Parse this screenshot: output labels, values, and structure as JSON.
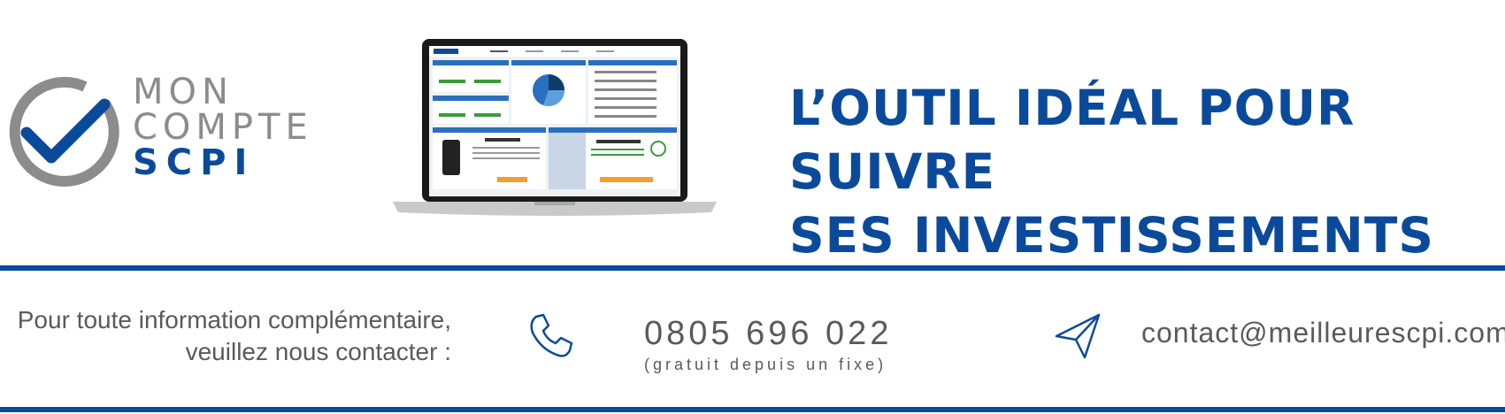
{
  "logo": {
    "line1": "MON",
    "line2": "COMPTE",
    "line3": "SCPI"
  },
  "headline": {
    "line1": "L’OUTIL IDÉAL POUR SUIVRE",
    "line2": "SES INVESTISSEMENTS"
  },
  "contact": {
    "info_line1": "Pour toute information complémentaire,",
    "info_line2": "veuillez nous contacter :",
    "phone": "0805 696 022",
    "phone_note": "(gratuit depuis un fixe)",
    "email": "contact@meilleurescpi.com",
    "icons": [
      "phone-icon",
      "paper-plane-icon"
    ]
  },
  "colors": {
    "brand_blue": "#0b4a9b",
    "logo_gray": "#8c8c8c",
    "text_gray": "#5a5a5a"
  }
}
